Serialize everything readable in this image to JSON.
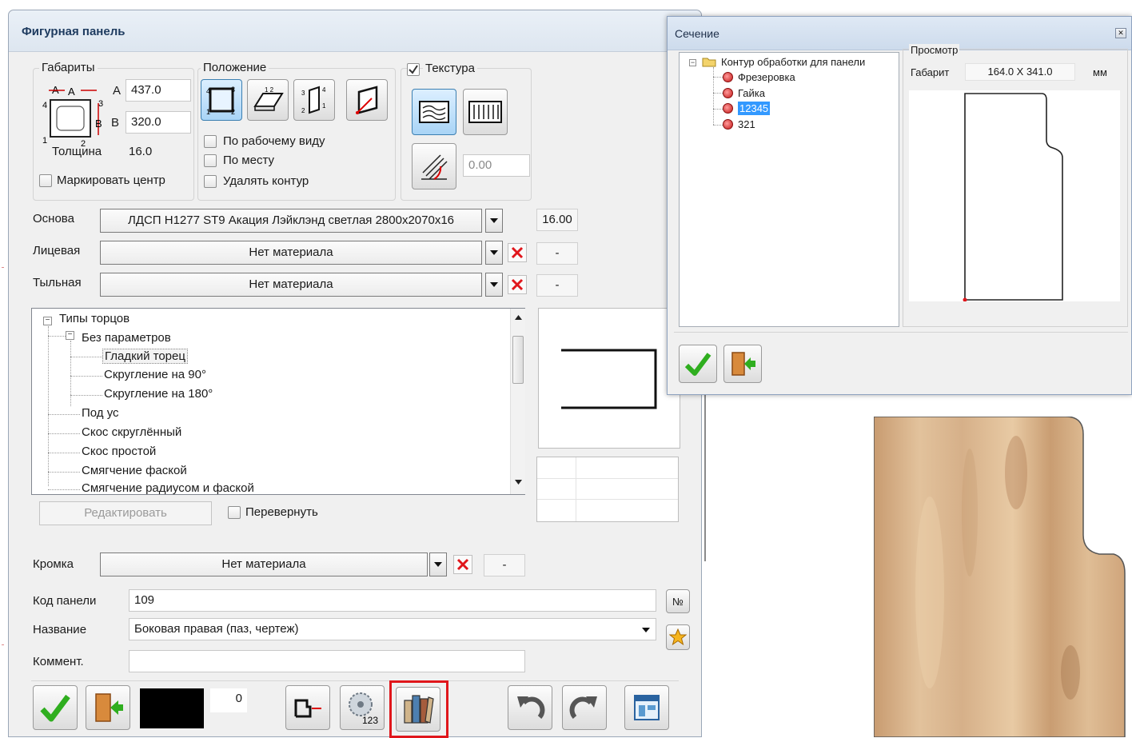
{
  "main_dialog": {
    "title": "Фигурная панель",
    "gabarity": {
      "legend": "Габариты",
      "a_label": "A",
      "a_value": "437.0",
      "b_label": "B",
      "b_value": "320.0",
      "thickness_label": "Толщина",
      "thickness_value": "16.0",
      "mark_center_label": "Маркировать центр"
    },
    "position": {
      "legend": "Положение",
      "by_work_view": "По рабочему виду",
      "in_place": "По месту",
      "remove_contour": "Удалять контур"
    },
    "texture": {
      "label": "Текстура",
      "angle_value": "0.00"
    },
    "materials": {
      "base_label": "Основа",
      "base_value": "ЛДСП Н1277 ST9 Акация Лэйклэнд светлая 2800x2070x16",
      "base_thickness": "16.00",
      "face_label": "Лицевая",
      "face_value": "Нет материала",
      "face_extra": "-",
      "back_label": "Тыльная",
      "back_value": "Нет материала",
      "back_extra": "-"
    },
    "edge_tree": {
      "root": "Типы торцов",
      "group": "Без параметров",
      "items": [
        "Гладкий торец",
        "Скругление на 90°",
        "Скругление на 180°"
      ],
      "others": [
        "Под ус",
        "Скос скруглённый",
        "Скос простой",
        "Смягчение фаской",
        "Смягчение радиусом и фаской"
      ]
    },
    "edit_button": "Редактировать",
    "flip_label": "Перевернуть",
    "edge_band": {
      "label": "Кромка",
      "value": "Нет материала",
      "extra": "-"
    },
    "panel_code": {
      "label": "Код панели",
      "value": "109",
      "number_button": "№"
    },
    "panel_name": {
      "label": "Название",
      "value": "Боковая правая  (паз, чертеж)"
    },
    "comment": {
      "label": "Коммент.",
      "value": ""
    },
    "color_counter": "0"
  },
  "section_dialog": {
    "title": "Сечение",
    "close": "✕",
    "tree_root": "Контур обработки для панели",
    "tree_items": [
      "Фрезеровка",
      "Гайка",
      "12345",
      "321"
    ],
    "selected_item": "12345",
    "preview_legend": "Просмотр",
    "size_label": "Габарит",
    "size_value": "164.0 X 341.0",
    "units": "мм"
  },
  "colors": {
    "accent": "#3c7fb1",
    "selection": "#3399ff",
    "highlight_border": "#e0161b",
    "ok_green": "#2fae1f",
    "wood_base": "#d8b48e"
  },
  "icons": {
    "ok": "check-icon",
    "cancel": "exit-door-icon",
    "undo": "undo-icon",
    "redo": "redo-icon"
  }
}
